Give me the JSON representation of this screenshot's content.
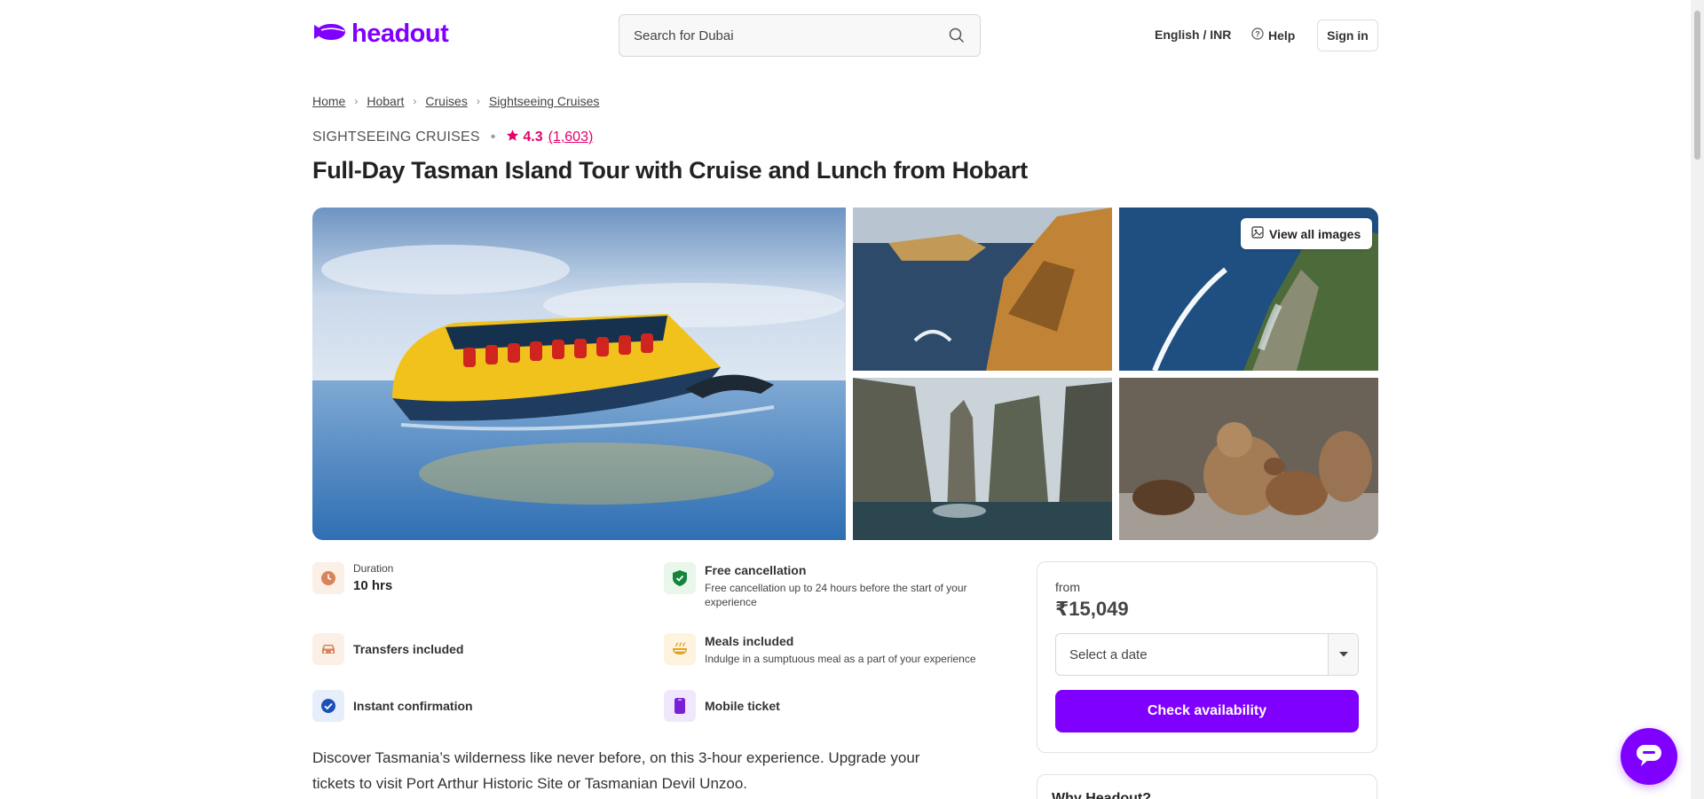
{
  "header": {
    "logo_text": "headout",
    "search_placeholder": "Search for Dubai",
    "language": "English / INR",
    "help": "Help",
    "sign_in": "Sign in"
  },
  "breadcrumb": [
    "Home",
    "Hobart",
    "Cruises",
    "Sightseeing Cruises"
  ],
  "product": {
    "category": "SIGHTSEEING CRUISES",
    "rating": "4.3",
    "rating_count": "(1,603)",
    "title": "Full-Day Tasman Island Tour with Cruise and Lunch from Hobart",
    "view_all_images": "View all images",
    "description": "Discover Tasmania’s wilderness like never before, on this 3-hour experience. Upgrade your tickets to visit Port Arthur Historic Site or Tasmanian Devil Unzoo."
  },
  "features": {
    "duration_label": "Duration",
    "duration_value": "10 hrs",
    "free_cancellation": "Free cancellation",
    "free_cancellation_desc": "Free cancellation up to 24 hours before the start of your experience",
    "transfers": "Transfers included",
    "meals": "Meals included",
    "meals_desc": "Indulge in a sumptuous meal as a part of your experience",
    "instant": "Instant confirmation",
    "mobile": "Mobile ticket"
  },
  "booking": {
    "from": "from",
    "price": "₹15,049",
    "date_placeholder": "Select a date",
    "cta": "Check availability"
  },
  "why": {
    "title": "Why Headout?"
  },
  "colors": {
    "brand": "#8000ff",
    "rating": "#e5006a"
  }
}
